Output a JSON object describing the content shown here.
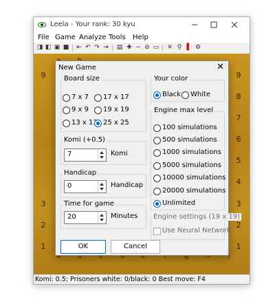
{
  "window": {
    "title": "Leela - Your rank: 30 kyu",
    "icon": "eye-icon",
    "controls": [
      "minimize-icon",
      "maximize-icon",
      "close-icon"
    ]
  },
  "menu": [
    "File",
    "Game",
    "Analyze",
    "Tools",
    "Help"
  ],
  "toolbar": {
    "icons": [
      "new-game-icon",
      "open-icon",
      "save-as-icon",
      "save-icon",
      "back-icon",
      "undo-icon",
      "redo-icon",
      "forward-icon",
      "set-icon",
      "add-icon",
      "remove-icon",
      "erase-icon",
      "clear-icon",
      "cut-icon",
      "zoom-icon",
      "flag-icon",
      "settings-icon"
    ],
    "glyphs": [
      "◨",
      "◧",
      "▣",
      "■",
      "⇤",
      "↶",
      "↷",
      "⇥",
      "▤",
      "✚",
      "−",
      "⊘",
      "▭",
      "✕",
      "⚲",
      "▌",
      "⚙"
    ]
  },
  "board": {
    "row_labels": [
      "9",
      "8",
      "7",
      "6",
      "5",
      "4",
      "3",
      "2",
      "1"
    ],
    "col_labels": [
      "a",
      "b",
      "c",
      "d",
      "e",
      "f",
      "g",
      "h",
      "j"
    ],
    "visible_col_labels": [
      "a",
      "b",
      "c",
      "d",
      "e",
      "f",
      "g",
      "h",
      "j"
    ]
  },
  "status": "Komi: 0.5; Prisoners white: 0/black: 0 Best move: F4",
  "dialog": {
    "title": "New Game",
    "close_glyph": "✕",
    "board_size": {
      "title": "Board size",
      "options": [
        "7 x 7",
        "17 x 17",
        "9 x 9",
        "19 x 19",
        "13 x 13",
        "25 x 25"
      ],
      "selected": "25 x 25"
    },
    "komi": {
      "title": "Komi (+0.5)",
      "value": "7",
      "unit": "Komi"
    },
    "handicap": {
      "title": "Handicap",
      "value": "0",
      "unit": "Handicap"
    },
    "time": {
      "title": "Time for game",
      "value": "20",
      "unit": "Minutes"
    },
    "color": {
      "title": "Your color",
      "options": [
        "Black",
        "White"
      ],
      "selected": "Black"
    },
    "engine": {
      "title": "Engine max level",
      "options": [
        "100 simulations",
        "500 simulations",
        "1000 simulations",
        "5000 simulations",
        "10000 simulations",
        "20000 simulations",
        "Unlimited"
      ],
      "selected": "Unlimited"
    },
    "engine_settings": {
      "title": "Engine settings (19 x 19)",
      "checkbox_label": "Use Neural Network",
      "checked": false
    },
    "ok_label": "OK",
    "cancel_label": "Cancel"
  },
  "colors": {
    "accent": "#0067c0",
    "board": "#c28e1e"
  }
}
